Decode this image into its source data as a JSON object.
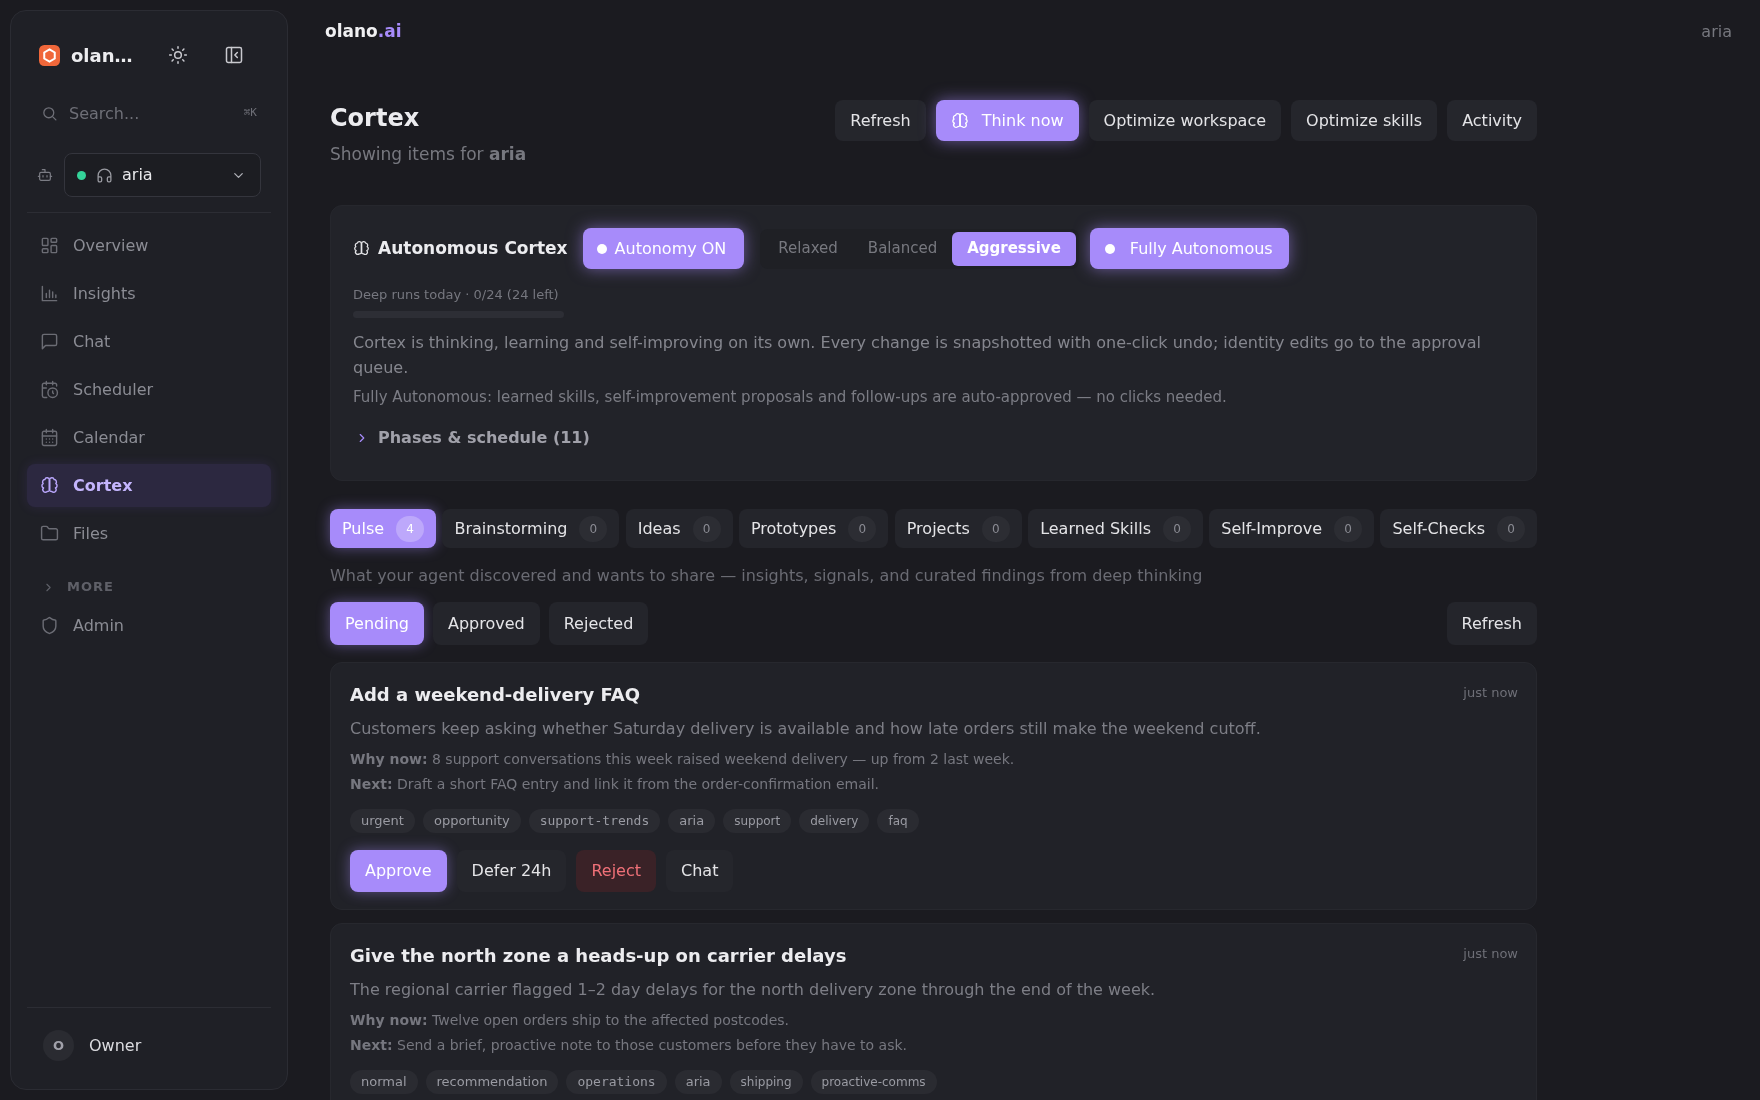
{
  "sidebar": {
    "brand": "olan…",
    "search": {
      "placeholder": "Search...",
      "shortcut": "⌘K"
    },
    "agent_select": {
      "value": "aria",
      "online": true
    },
    "nav": [
      {
        "label": "Overview",
        "selected": false
      },
      {
        "label": "Insights",
        "selected": false
      },
      {
        "label": "Chat",
        "selected": false
      },
      {
        "label": "Scheduler",
        "selected": false
      },
      {
        "label": "Calendar",
        "selected": false
      },
      {
        "label": "Cortex",
        "selected": true
      },
      {
        "label": "Files",
        "selected": false
      }
    ],
    "more": {
      "label": "MORE",
      "expanded": false
    },
    "more_nav": [
      {
        "label": "Admin",
        "selected": false
      }
    ],
    "user": {
      "initial": "O",
      "name": "Owner"
    }
  },
  "topbar": {
    "brand": {
      "name": "olano",
      "suffix": ".ai"
    },
    "user": "aria"
  },
  "page": {
    "title": "Cortex",
    "subtitle": "Showing items for **aria**",
    "actions": [
      {
        "label": "Refresh",
        "kind": "default"
      },
      {
        "label": "Think now",
        "kind": "primary"
      },
      {
        "label": "Optimize workspace",
        "kind": "default"
      },
      {
        "label": "Optimize skills",
        "kind": "default"
      },
      {
        "label": "Activity",
        "kind": "default"
      }
    ]
  },
  "autonomy_panel": {
    "title": "Autonomous Cortex",
    "autonomy_toggle": {
      "label": "Autonomy ON",
      "on": true
    },
    "modes": [
      {
        "label": "Relaxed",
        "selected": false
      },
      {
        "label": "Balanced",
        "selected": false
      },
      {
        "label": "Aggressive",
        "selected": true
      }
    ],
    "full_autonomy": {
      "label": "Fully Autonomous",
      "on": true
    },
    "deep_runs": {
      "label": "Deep runs today · 0/24 (24 left)",
      "level": 0
    },
    "description": "Cortex is thinking, learning and self-improving on its own. Every change is snapshotted with one-click undo; identity edits go to the approval queue.",
    "note": "Fully Autonomous: learned skills, self-improvement proposals and follow-ups are auto-approved — no clicks needed.",
    "phases": {
      "label": "Phases & schedule (11)",
      "expanded": false
    }
  },
  "tabs": [
    {
      "label": "Pulse",
      "count": "4",
      "selected": true
    },
    {
      "label": "Brainstorming",
      "count": "0",
      "selected": false
    },
    {
      "label": "Ideas",
      "count": "0",
      "selected": false
    },
    {
      "label": "Prototypes",
      "count": "0",
      "selected": false
    },
    {
      "label": "Projects",
      "count": "0",
      "selected": false
    },
    {
      "label": "Learned Skills",
      "count": "0",
      "selected": false
    },
    {
      "label": "Self-Improve",
      "count": "0",
      "selected": false
    },
    {
      "label": "Self-Checks",
      "count": "0",
      "selected": false
    }
  ],
  "tab_description": "What your agent discovered and wants to share — insights, signals, and curated findings from deep thinking",
  "filters": [
    {
      "label": "Pending",
      "selected": true
    },
    {
      "label": "Approved",
      "selected": false
    },
    {
      "label": "Rejected",
      "selected": false
    }
  ],
  "filter_refresh": "Refresh",
  "cards": [
    {
      "title": "Add a weekend-delivery FAQ",
      "time": "just now",
      "description": "Customers keep asking whether Saturday delivery is available and how late orders still make the weekend cutoff.",
      "why": "**Why now:** 8 support conversations this week raised weekend delivery — up from 2 last week.",
      "next": "**Next:** Draft a short FAQ entry and link it from the order-confirmation email.",
      "tags": [
        {
          "label": "urgent",
          "kind": "priority"
        },
        {
          "label": "opportunity",
          "kind": "category"
        },
        {
          "label": "support-trends",
          "kind": "topic"
        },
        {
          "label": "aria",
          "kind": "agent"
        },
        {
          "label": "support",
          "kind": "keyword"
        },
        {
          "label": "delivery",
          "kind": "keyword"
        },
        {
          "label": "faq",
          "kind": "keyword"
        }
      ],
      "actions": [
        {
          "label": "Approve",
          "kind": "primary"
        },
        {
          "label": "Defer 24h",
          "kind": "default"
        },
        {
          "label": "Reject",
          "kind": "danger"
        },
        {
          "label": "Chat",
          "kind": "default"
        }
      ]
    },
    {
      "title": "Give the north zone a heads-up on carrier delays",
      "time": "just now",
      "description": "The regional carrier flagged 1–2 day delays for the north delivery zone through the end of the week.",
      "why": "**Why now:** Twelve open orders ship to the affected postcodes.",
      "next": "**Next:** Send a brief, proactive note to those customers before they have to ask.",
      "tags": [
        {
          "label": "normal",
          "kind": "priority"
        },
        {
          "label": "recommendation",
          "kind": "category"
        },
        {
          "label": "operations",
          "kind": "topic"
        },
        {
          "label": "aria",
          "kind": "agent"
        },
        {
          "label": "shipping",
          "kind": "keyword"
        },
        {
          "label": "proactive-comms",
          "kind": "keyword"
        }
      ]
    }
  ]
}
